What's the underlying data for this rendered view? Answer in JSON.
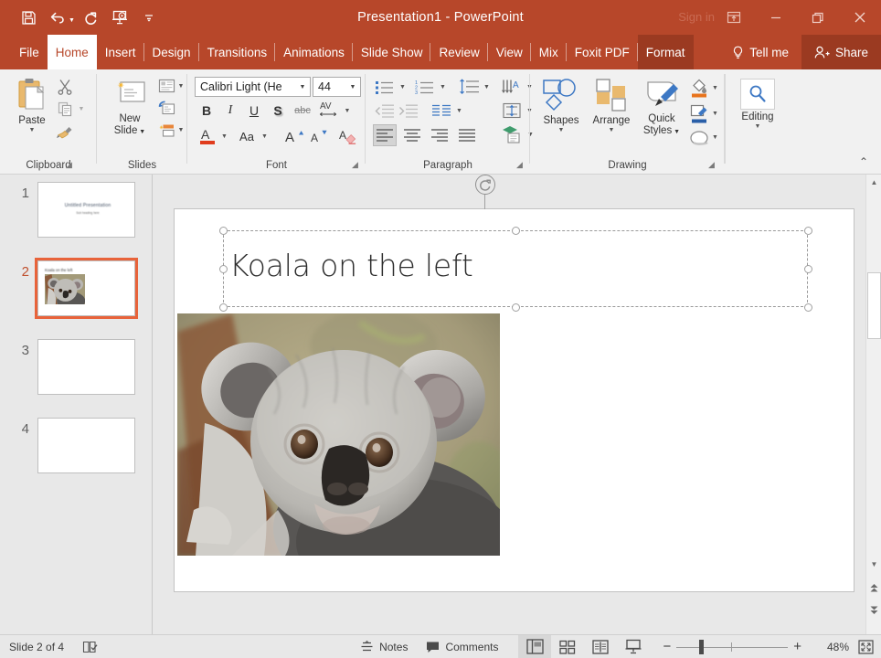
{
  "window": {
    "title": "Presentation1  -  PowerPoint",
    "signin": "Sign in",
    "quick_access": [
      {
        "name": "save-icon",
        "label": "Save"
      },
      {
        "name": "undo-icon",
        "label": "Undo"
      },
      {
        "name": "redo-icon",
        "label": "Redo"
      },
      {
        "name": "start-from-beginning-icon",
        "label": "Start From Beginning"
      },
      {
        "name": "customize-quick-access-toolbar-icon",
        "label": "Customize Quick Access Toolbar"
      }
    ],
    "controls": [
      {
        "name": "ribbon-display-options-icon",
        "label": "Ribbon Display Options"
      },
      {
        "name": "minimize-icon",
        "label": "Minimize"
      },
      {
        "name": "restore-icon",
        "label": "Restore Down"
      },
      {
        "name": "close-icon",
        "label": "Close"
      }
    ],
    "accent_color": "#b7472a",
    "contextual_color": "#9b3a21"
  },
  "tabs": [
    {
      "label": "File",
      "active": false
    },
    {
      "label": "Home",
      "active": true
    },
    {
      "label": "Insert",
      "active": false
    },
    {
      "label": "Design",
      "active": false
    },
    {
      "label": "Transitions",
      "active": false
    },
    {
      "label": "Animations",
      "active": false
    },
    {
      "label": "Slide Show",
      "active": false
    },
    {
      "label": "Review",
      "active": false
    },
    {
      "label": "View",
      "active": false
    },
    {
      "label": "Mix",
      "active": false
    },
    {
      "label": "Foxit PDF",
      "active": false
    },
    {
      "label": "Format",
      "active": false,
      "contextual": true
    }
  ],
  "tabs_right": {
    "tell_me": "Tell me",
    "share": "Share"
  },
  "ribbon": {
    "groups": [
      {
        "label": "Clipboard",
        "dialog_launcher": true
      },
      {
        "label": "Slides",
        "dialog_launcher": false
      },
      {
        "label": "Font",
        "dialog_launcher": true
      },
      {
        "label": "Paragraph",
        "dialog_launcher": true
      },
      {
        "label": "Drawing",
        "dialog_launcher": true
      },
      {
        "label": "Editing",
        "dialog_launcher": false
      }
    ],
    "clipboard": {
      "paste": "Paste",
      "cut": "Cut",
      "copy": "Copy",
      "format_painter": "Format Painter"
    },
    "slides": {
      "new_slide": "New\nSlide",
      "new_slide_line1": "New",
      "new_slide_line2": "Slide",
      "layout": "Layout",
      "reset": "Reset",
      "section": "Section"
    },
    "font": {
      "font_name": "Calibri Light (He",
      "font_size": "44",
      "bold": "B",
      "italic": "I",
      "underline": "U",
      "shadow": "S",
      "strikethrough": "abc",
      "character_spacing": "AV",
      "font_color": "A",
      "change_case": "Aa",
      "increase_size": "A",
      "decrease_size": "A",
      "clear_formatting": "Clear All Formatting"
    },
    "paragraph": {
      "bullets": "Bullets",
      "numbering": "Numbering",
      "decrease_indent": "Decrease List Level",
      "increase_indent": "Increase List Level",
      "line_spacing": "Line Spacing",
      "text_direction": "Text Direction",
      "align_text": "Align Text",
      "columns": "Columns",
      "align_left": "Align Left",
      "align_center": "Center",
      "align_right": "Align Right",
      "justify": "Justify",
      "convert_smartart": "Convert to SmartArt"
    },
    "drawing": {
      "shapes": "Shapes",
      "arrange": "Arrange",
      "quick_styles_line1": "Quick",
      "quick_styles_line2": "Styles",
      "shape_fill": "Shape Fill",
      "shape_outline": "Shape Outline",
      "shape_effects": "Shape Effects"
    },
    "editing": {
      "editing": "Editing"
    },
    "collapse": "Collapse the Ribbon"
  },
  "thumbnails": [
    {
      "number": "1",
      "selected": false,
      "title": "Untitled Presentation",
      "subtitle": "Sub heading here"
    },
    {
      "number": "2",
      "selected": true,
      "title": "Koala on the left",
      "has_image": true
    },
    {
      "number": "3",
      "selected": false,
      "title": ""
    },
    {
      "number": "4",
      "selected": false,
      "title": ""
    }
  ],
  "slide": {
    "title_text": "Koala on the left",
    "title_selected": true,
    "image_alt": "koala-photo"
  },
  "status": {
    "slide_indicator": "Slide 2 of 4",
    "language_icon": "spell-check-icon",
    "notes": "Notes",
    "comments": "Comments",
    "views": [
      {
        "name": "normal-view-button",
        "label": "Normal",
        "active": true
      },
      {
        "name": "slide-sorter-view-button",
        "label": "Slide Sorter",
        "active": false
      },
      {
        "name": "reading-view-button",
        "label": "Reading View",
        "active": false
      },
      {
        "name": "slide-show-button",
        "label": "Slide Show",
        "active": false
      }
    ],
    "zoom_out": "−",
    "zoom_in": "+",
    "zoom_level": "48%",
    "fit_to_window": "Fit slide to current window"
  }
}
